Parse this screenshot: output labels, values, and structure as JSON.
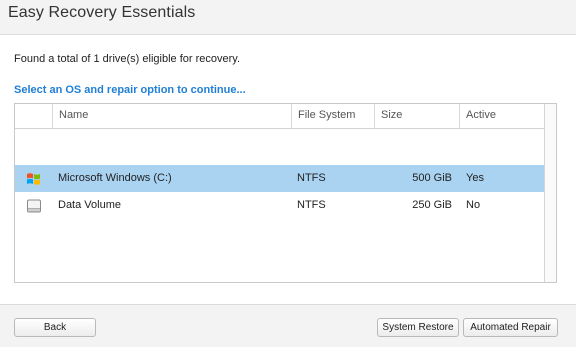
{
  "window": {
    "title": "Easy Recovery Essentials"
  },
  "main": {
    "found_text": "Found a total of 1 drive(s) eligible for recovery.",
    "prompt": "Select an OS and repair option to continue..."
  },
  "table": {
    "columns": [
      "Name",
      "File System",
      "Size",
      "Active"
    ],
    "rows": [
      {
        "icon": "windows-logo-icon",
        "name": "Microsoft Windows (C:)",
        "fs": "NTFS",
        "size": "500 GiB",
        "active": "Yes",
        "selected": true
      },
      {
        "icon": "drive-icon",
        "name": "Data Volume",
        "fs": "NTFS",
        "size": "250 GiB",
        "active": "No",
        "selected": false
      }
    ]
  },
  "footer": {
    "back_label": "Back",
    "system_restore_label": "System Restore",
    "automated_repair_label": "Automated Repair"
  },
  "colors": {
    "accent": "#1f7fd6",
    "selection": "#a9d3f1"
  }
}
